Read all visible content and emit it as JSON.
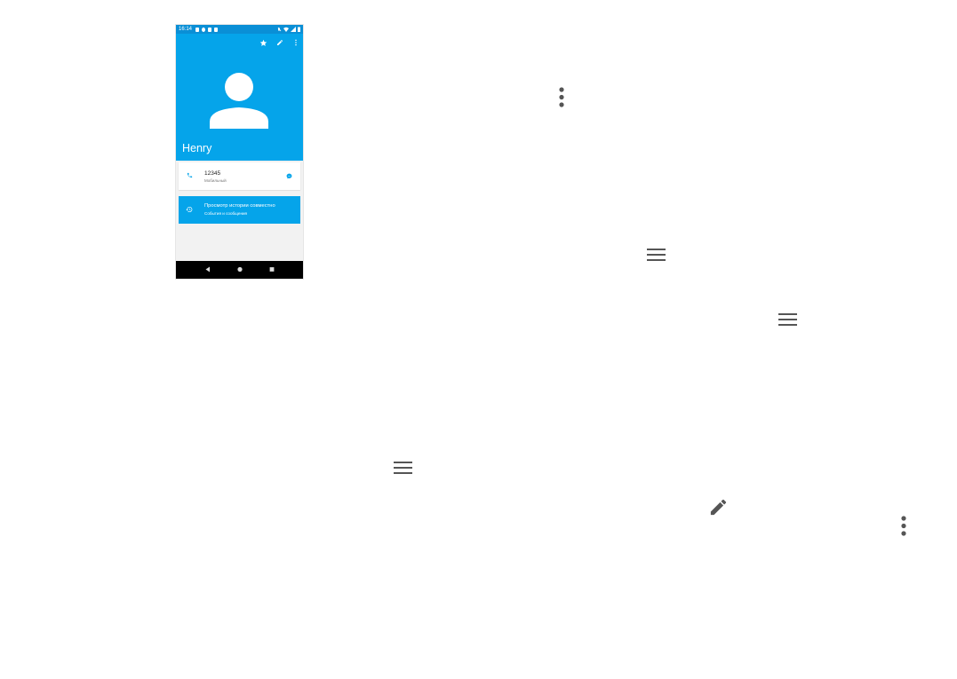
{
  "status_bar": {
    "time": "16:14"
  },
  "contact": {
    "name": "Henry"
  },
  "phone_entry": {
    "number": "12345",
    "label": "Мобильный"
  },
  "history": {
    "title": "Просмотр истории совместно",
    "subtitle": "События и сообщения"
  },
  "colors": {
    "header": "#05a4ea",
    "status_bar": "#0a8fd6",
    "icon_gray": "#555555"
  },
  "icons": {
    "header": [
      "star-icon",
      "edit-icon",
      "more-vert-icon"
    ],
    "nav": [
      "back-icon",
      "home-icon",
      "recents-icon"
    ],
    "floating": [
      "more-vert-icon",
      "menu-icon",
      "menu-icon",
      "menu-icon",
      "edit-icon",
      "more-vert-icon"
    ]
  }
}
